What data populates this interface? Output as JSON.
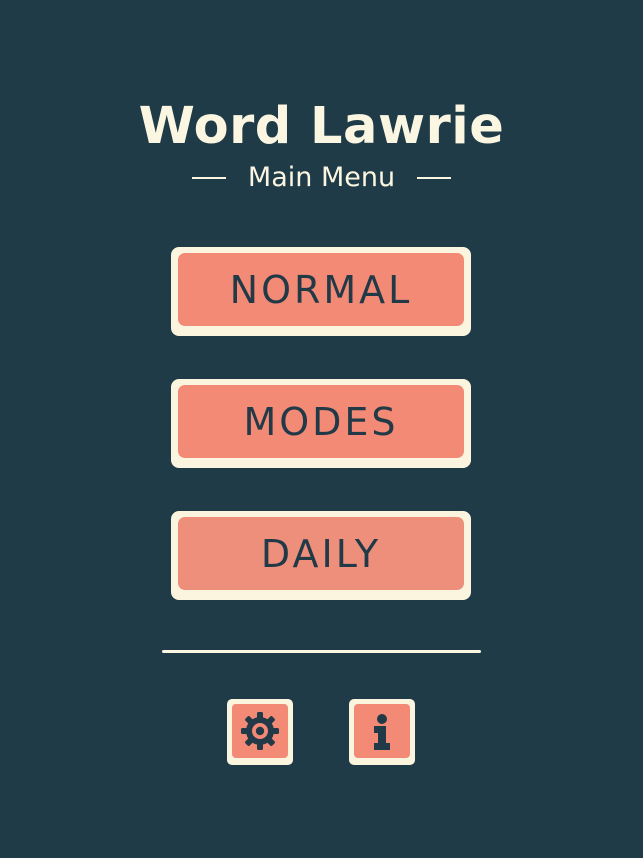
{
  "header": {
    "title": "Word Lawrie",
    "subtitle": "Main Menu"
  },
  "menu": {
    "normal_label": "NORMAL",
    "modes_label": "MODES",
    "daily_label": "DAILY"
  },
  "footer": {
    "settings_icon": "gear-icon",
    "info_icon": "info-icon"
  },
  "colors": {
    "background": "#1f3b47",
    "button_fill": "#f38a76",
    "button_border": "#fbf5df",
    "text_light": "#fbf6e2",
    "text_dark": "#223a47"
  }
}
